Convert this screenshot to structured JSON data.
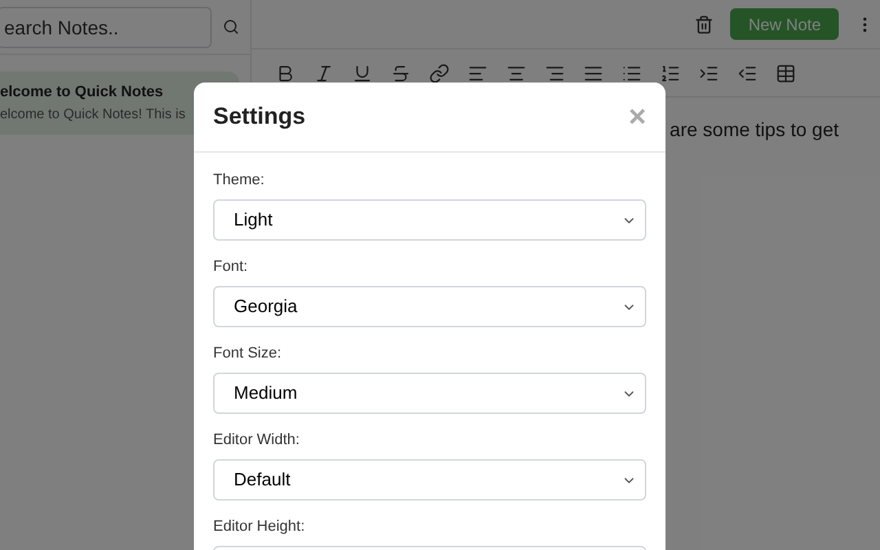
{
  "sidebar": {
    "search": {
      "placeholder": "earch Notes.."
    },
    "notes": [
      {
        "title": "elcome to Quick Notes",
        "preview": "elcome to Quick Notes! This is",
        "selected": true
      }
    ]
  },
  "topbar": {
    "new_note": "New Note"
  },
  "toolbar": [
    {
      "kind": "bold"
    },
    {
      "kind": "italic"
    },
    {
      "kind": "underline"
    },
    {
      "kind": "strikethrough"
    },
    {
      "kind": "link"
    },
    {
      "kind": "align-left"
    },
    {
      "kind": "align-center"
    },
    {
      "kind": "align-right"
    },
    {
      "kind": "align-justify"
    },
    {
      "kind": "bullet-list"
    },
    {
      "kind": "numbered-list"
    },
    {
      "kind": "indent"
    },
    {
      "kind": "outdent"
    },
    {
      "kind": "table"
    }
  ],
  "editor": {
    "text": "are some tips to get"
  },
  "dialog": {
    "title": "Settings",
    "close": "×",
    "fields": [
      {
        "label": "Theme:",
        "value": "Light"
      },
      {
        "label": "Font:",
        "value": "Georgia"
      },
      {
        "label": "Font Size:",
        "value": "Medium"
      },
      {
        "label": "Editor Width:",
        "value": "Default"
      },
      {
        "label": "Editor Height:"
      }
    ]
  }
}
